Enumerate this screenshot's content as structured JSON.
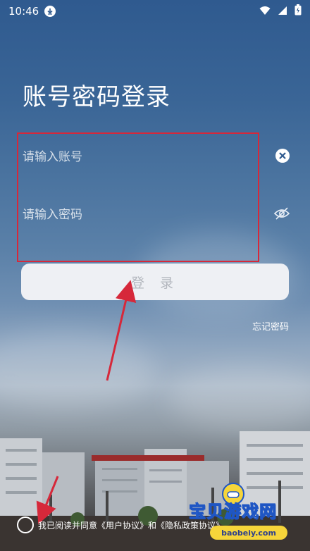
{
  "status_bar": {
    "time": "10:46",
    "icons": [
      "download-icon",
      "wifi-icon",
      "battery-icon"
    ]
  },
  "page": {
    "title": "账号密码登录"
  },
  "form": {
    "account_placeholder": "请输入账号",
    "password_placeholder": "请输入密码",
    "clear_icon": "clear-icon",
    "visibility_icon": "eye-off-icon",
    "login_label": "登 录",
    "forgot_label": "忘记密码"
  },
  "agreement": {
    "prefix": "我已阅读并同意",
    "user_agreement": "《用户协议》",
    "and": "和",
    "privacy_policy": "《隐私政策协议》"
  },
  "watermark": {
    "text": "宝贝游戏网",
    "url": "baobeiy.com"
  },
  "colors": {
    "highlight": "#d6283a",
    "arrow": "#d6283a",
    "button_bg": "#eef0f4",
    "button_text": "#b3b7be"
  }
}
